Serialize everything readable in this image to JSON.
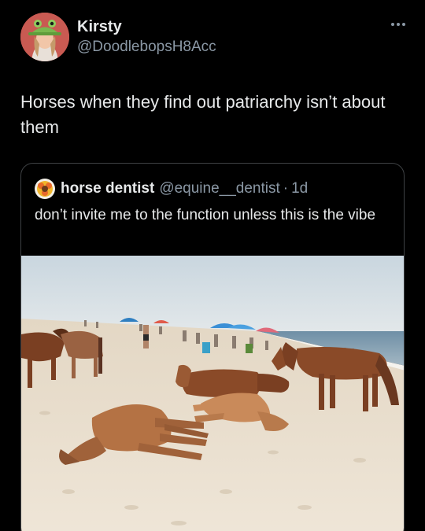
{
  "tweet": {
    "author": {
      "display_name": "Kirsty",
      "handle": "@DoodlebopsH8Acc",
      "avatar_icon": "frog-hat-avatar"
    },
    "more_icon": "more-dots-icon",
    "text": "Horses when they find out patriarchy isn’t about them"
  },
  "quoted_tweet": {
    "author": {
      "display_name": "horse dentist",
      "handle": "@equine__dentist",
      "avatar_icon": "sunflower-avatar"
    },
    "separator": "·",
    "time": "1d",
    "text": "don’t invite me to the function unless this is the vibe",
    "media": {
      "type": "photo",
      "subject": "wild horses lying on a crowded beach"
    }
  },
  "colors": {
    "background": "#000000",
    "primary_text": "#e7e9ea",
    "secondary_text": "#8b98a5",
    "border": "#3e4144"
  }
}
